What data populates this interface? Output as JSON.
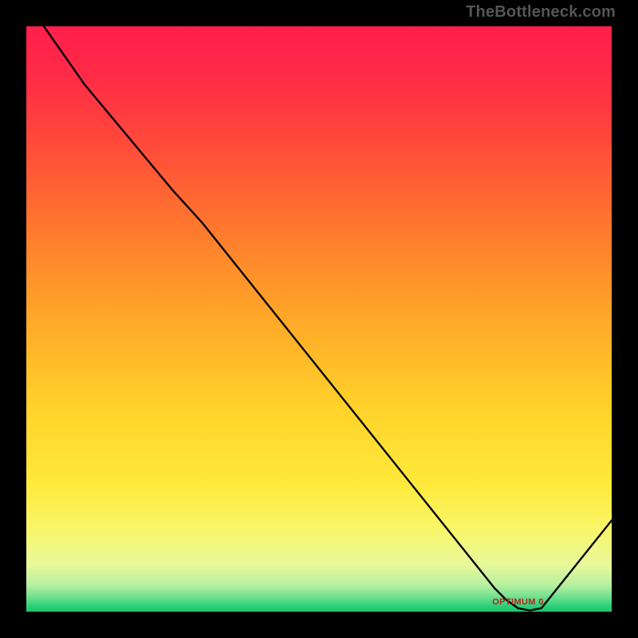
{
  "watermark": "TheBottleneck.com",
  "chart_data": {
    "type": "line",
    "title": "",
    "xlabel": "",
    "ylabel": "",
    "xlim": [
      0,
      100
    ],
    "ylim": [
      0,
      100
    ],
    "x": [
      3,
      10,
      20,
      25,
      30,
      40,
      50,
      60,
      70,
      78,
      80,
      82,
      84,
      86,
      88,
      96,
      100
    ],
    "values": [
      100,
      90,
      78,
      72,
      66.5,
      54,
      41.5,
      29,
      16.5,
      6.5,
      4,
      2,
      0.6,
      0.2,
      0.6,
      10.6,
      15.6
    ],
    "baseline_label": {
      "text": "OPTIMUM 0",
      "x": 84,
      "y": 0.8
    },
    "gradient_stops": [
      {
        "offset": 0.0,
        "color": "#ff1f4b"
      },
      {
        "offset": 0.08,
        "color": "#ff2a47"
      },
      {
        "offset": 0.2,
        "color": "#ff4a3a"
      },
      {
        "offset": 0.35,
        "color": "#ff7a2d"
      },
      {
        "offset": 0.5,
        "color": "#ffa828"
      },
      {
        "offset": 0.65,
        "color": "#ffd22a"
      },
      {
        "offset": 0.78,
        "color": "#ffe93a"
      },
      {
        "offset": 0.86,
        "color": "#f9f76a"
      },
      {
        "offset": 0.92,
        "color": "#e8f99a"
      },
      {
        "offset": 0.955,
        "color": "#b6f0a0"
      },
      {
        "offset": 0.975,
        "color": "#6fe08e"
      },
      {
        "offset": 0.99,
        "color": "#2fd07a"
      },
      {
        "offset": 1.0,
        "color": "#18c46e"
      }
    ]
  }
}
